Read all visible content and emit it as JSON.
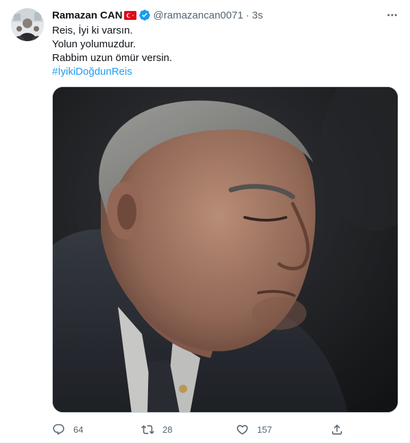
{
  "tweet": {
    "author_name": "Ramazan CAN",
    "author_handle": "@ramazancan0071",
    "separator": "·",
    "time": "3s",
    "lines": [
      "Reis, İyi ki varsın.",
      "Yolun yolumuzdur.",
      "Rabbim uzun ömür versin."
    ],
    "hashtag": "#İyikiDoğdunReis",
    "icons": {
      "flag": "turkey-flag-icon",
      "verified": "verified-badge-icon",
      "more": "more-icon"
    }
  },
  "actions": {
    "reply_count": "64",
    "retweet_count": "28",
    "like_count": "157"
  },
  "colors": {
    "accent": "#1d9bf0",
    "muted": "#536471",
    "text": "#0f1419"
  }
}
